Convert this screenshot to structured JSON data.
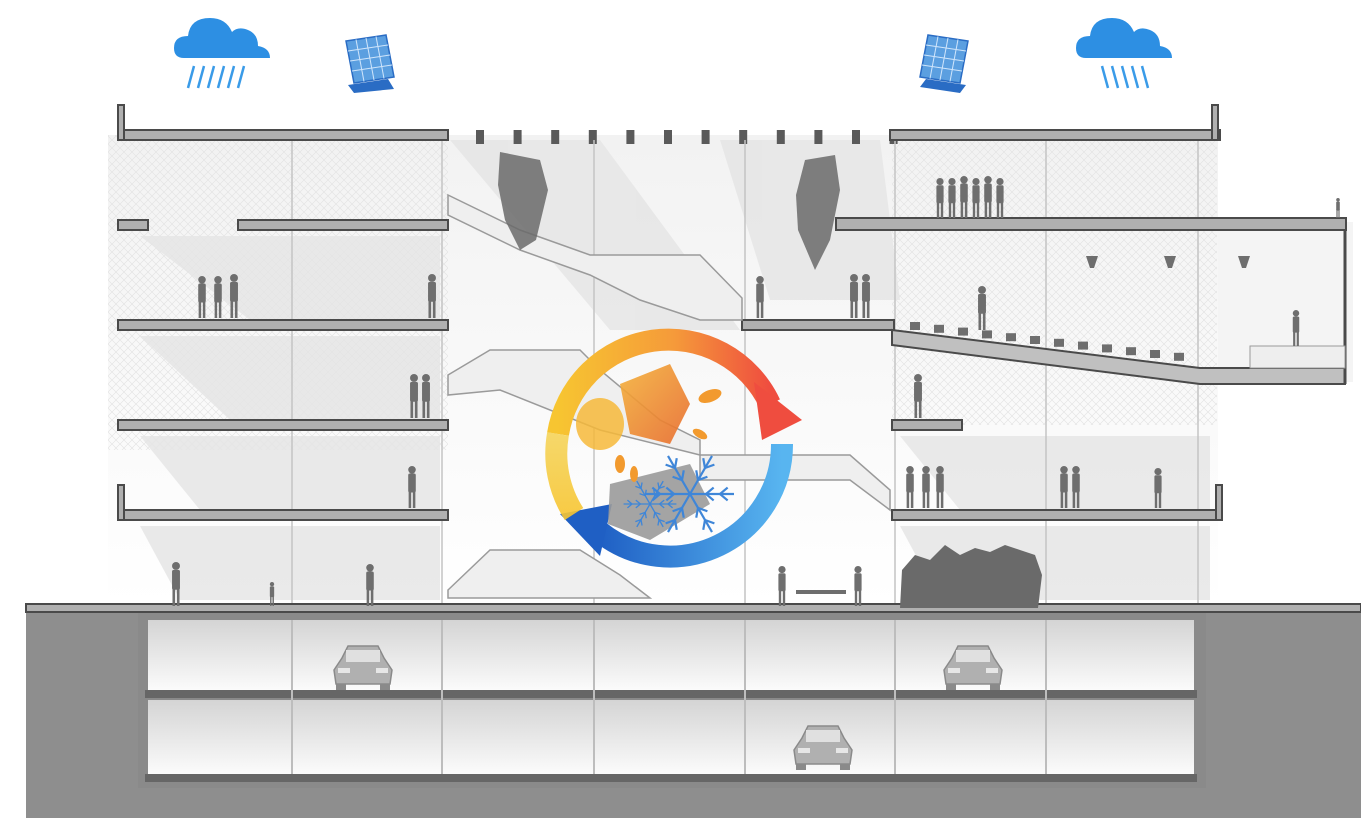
{
  "diagram": {
    "colors": {
      "sky": "#ffffff",
      "ground": "#8e8e8e",
      "ground_dark": "#7a7a7a",
      "slab": "#555555",
      "slab_fill": "#9a9a9a",
      "facade": "#dcdcdc",
      "interior_shade": "#e9e9e9",
      "silhouette": "#6e6e6e",
      "car": "#a8a8a8",
      "cloud": "#2d8fe3",
      "rain": "#3a9be8",
      "solar_panel": "#5b9fe0",
      "solar_base": "#2a6cc4",
      "cycle_yellow": "#f7c531",
      "cycle_orange": "#f47a3a",
      "cycle_red": "#ef4d3f",
      "cycle_blue": "#2f8fe0",
      "cycle_dark_blue": "#1f5fc4",
      "snowflake": "#3f86d8",
      "flame": "#f29a2e"
    },
    "icons": [
      "rain-cloud-icon",
      "solar-panel-icon",
      "heating-cooling-cycle-icon",
      "snowflake-icon",
      "car-icon",
      "person-silhouette-icon"
    ]
  }
}
